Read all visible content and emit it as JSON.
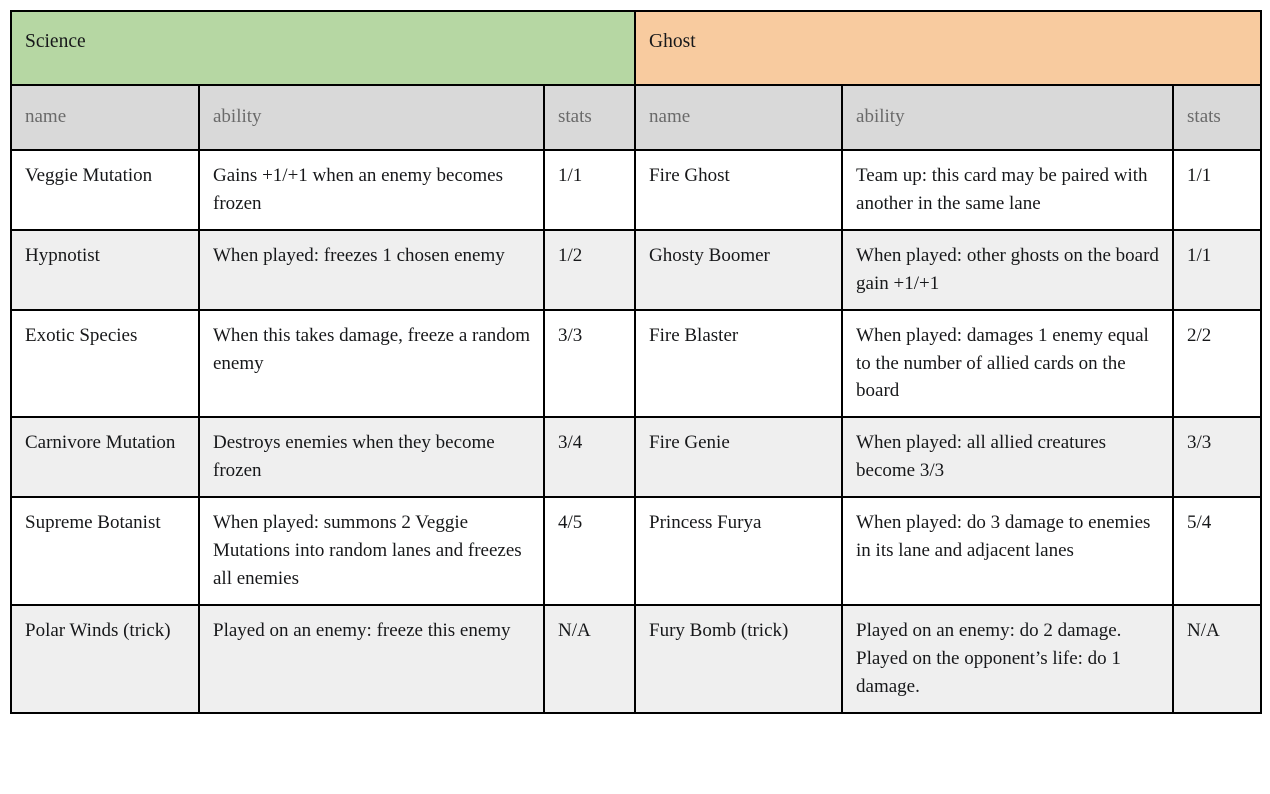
{
  "table": {
    "factions": [
      {
        "id": "science",
        "label": "Science",
        "color": "#b6d7a3"
      },
      {
        "id": "ghost",
        "label": "Ghost",
        "color": "#f8cb9f"
      }
    ],
    "column_headers": {
      "science": {
        "name": "name",
        "ability": "ability",
        "stats": "stats"
      },
      "ghost": {
        "name": "name",
        "ability": "ability",
        "stats": "stats"
      }
    },
    "rows": [
      {
        "science": {
          "name": "Veggie Mutation",
          "ability": "Gains +1/+1 when an enemy becomes frozen",
          "stats": "1/1"
        },
        "ghost": {
          "name": "Fire Ghost",
          "ability": "Team up: this card may be paired with another in the same lane",
          "stats": "1/1"
        }
      },
      {
        "science": {
          "name": "Hypnotist",
          "ability": "When played: freezes 1 chosen enemy",
          "stats": "1/2"
        },
        "ghost": {
          "name": "Ghosty Boomer",
          "ability": "When played: other ghosts on the board gain +1/+1",
          "stats": "1/1"
        }
      },
      {
        "science": {
          "name": "Exotic Species",
          "ability": "When this takes damage, freeze a random enemy",
          "stats": "3/3"
        },
        "ghost": {
          "name": "Fire Blaster",
          "ability": "When played: damages 1 enemy equal to the number of allied cards on the board",
          "stats": "2/2"
        }
      },
      {
        "science": {
          "name": "Carnivore Mutation",
          "ability": "Destroys enemies when they become frozen",
          "stats": "3/4"
        },
        "ghost": {
          "name": "Fire Genie",
          "ability": "When played: all allied creatures become 3/3",
          "stats": "3/3"
        }
      },
      {
        "science": {
          "name": "Supreme Botanist",
          "ability": "When played: summons 2 Veggie Mutations into random lanes and freezes all enemies",
          "stats": "4/5"
        },
        "ghost": {
          "name": "Princess Furya",
          "ability": "When played: do 3 damage to enemies in its lane and adjacent lanes",
          "stats": "5/4"
        }
      },
      {
        "science": {
          "name": "Polar Winds (trick)",
          "ability": "Played on an enemy: freeze this enemy",
          "stats": "N/A"
        },
        "ghost": {
          "name": "Fury Bomb (trick)",
          "ability": "Played on an enemy: do 2 damage. Played on the opponent’s life: do 1 damage.",
          "stats": "N/A"
        }
      }
    ]
  }
}
